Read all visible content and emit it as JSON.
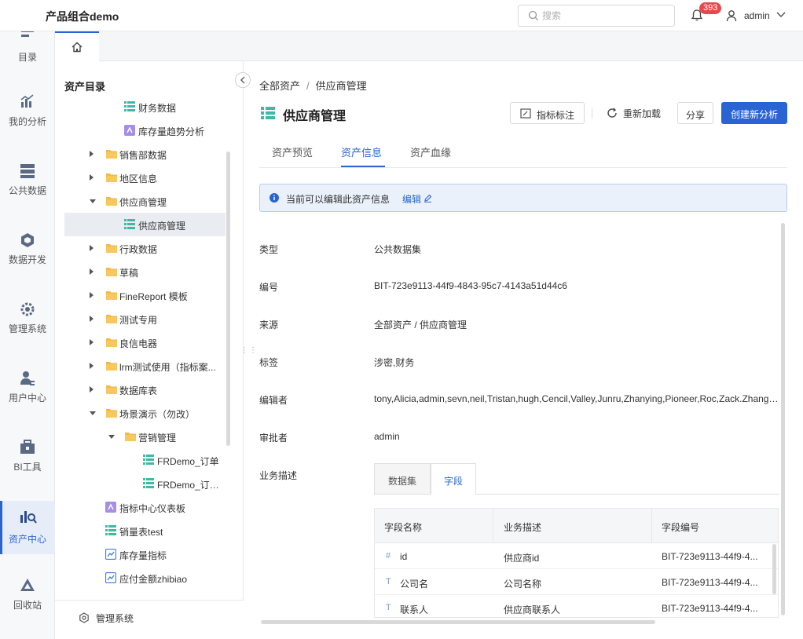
{
  "app": {
    "title": "产品组合demo"
  },
  "header": {
    "search_placeholder": "搜索",
    "notification_count": "393",
    "user": "admin"
  },
  "leftnav": [
    {
      "label": "目录",
      "icon": "catalog-icon"
    },
    {
      "label": "我的分析",
      "icon": "chart-icon"
    },
    {
      "label": "公共数据",
      "icon": "database-icon"
    },
    {
      "label": "数据开发",
      "icon": "cube-icon"
    },
    {
      "label": "管理系统",
      "icon": "gear-icon"
    },
    {
      "label": "用户中心",
      "icon": "user-icon"
    },
    {
      "label": "BI工具",
      "icon": "toolbox-icon"
    },
    {
      "label": "资产中心",
      "icon": "asset-search-icon",
      "active": true
    },
    {
      "label": "回收站",
      "icon": "recycle-icon"
    }
  ],
  "tree": {
    "title": "资产目录",
    "items": [
      {
        "label": "财务数据",
        "type": "dataset"
      },
      {
        "label": "库存量趋势分析",
        "type": "analysis"
      },
      {
        "label": "销售部数据",
        "type": "folder"
      },
      {
        "label": "地区信息",
        "type": "folder"
      },
      {
        "label": "供应商管理",
        "type": "folder"
      },
      {
        "label": "供应商管理",
        "type": "dataset"
      },
      {
        "label": "行政数据",
        "type": "folder"
      },
      {
        "label": "草稿",
        "type": "folder"
      },
      {
        "label": "FineReport 模板",
        "type": "folder"
      },
      {
        "label": "测试专用",
        "type": "folder"
      },
      {
        "label": "良信电器",
        "type": "folder"
      },
      {
        "label": "lrm测试使用（指标案...",
        "type": "folder"
      },
      {
        "label": "数据库表",
        "type": "folder"
      },
      {
        "label": "场景演示（勿改）",
        "type": "folder"
      },
      {
        "label": "营销管理",
        "type": "folder"
      },
      {
        "label": "FRDemo_订单",
        "type": "dataset"
      },
      {
        "label": "FRDemo_订单...",
        "type": "dataset"
      },
      {
        "label": "指标中心仪表板",
        "type": "analysis"
      },
      {
        "label": "销量表test",
        "type": "dataset"
      },
      {
        "label": "库存量指标",
        "type": "metric"
      },
      {
        "label": "应付金额zhibiao",
        "type": "metric"
      }
    ],
    "footer": "管理系统"
  },
  "breadcrumb": {
    "root": "全部资产",
    "sep": "/",
    "current": "供应商管理"
  },
  "page": {
    "title": "供应商管理",
    "btn_metric": "指标标注",
    "btn_reload": "重新加载",
    "btn_share": "分享",
    "btn_create": "创建新分析"
  },
  "tabs": [
    "资产预览",
    "资产信息",
    "资产血缘"
  ],
  "notice": {
    "text": "当前可以编辑此资产信息",
    "edit": "编辑"
  },
  "fields": [
    {
      "label": "类型",
      "value": "公共数据集"
    },
    {
      "label": "编号",
      "value": "BIT-723e9113-44f9-4843-95c7-4143a51d44c6"
    },
    {
      "label": "来源",
      "value": "全部资产 / 供应商管理"
    },
    {
      "label": "标签",
      "value": "涉密,财务"
    },
    {
      "label": "编辑者",
      "value": "tony,Alicia,admin,sevn,neil,Tristan,hugh,Cencil,Valley,Junru,Zhanying,Pioneer,Roc,Zack.Zhang,Leon..."
    },
    {
      "label": "审批者",
      "value": "admin"
    },
    {
      "label": "业务描述",
      "value": ""
    }
  ],
  "subtabs": [
    "数据集",
    "字段"
  ],
  "table": {
    "headers": [
      "字段名称",
      "业务描述",
      "字段编号"
    ],
    "rows": [
      {
        "type": "#",
        "name": "id",
        "desc": "供应商id",
        "code": "BIT-723e9113-44f9-4..."
      },
      {
        "type": "T",
        "name": "公司名",
        "desc": "公司名称",
        "code": "BIT-723e9113-44f9-4..."
      },
      {
        "type": "T",
        "name": "联系人",
        "desc": "供应商联系人",
        "code": "BIT-723e9113-44f9-4..."
      }
    ]
  },
  "colors": {
    "accent": "#2a64d3",
    "folder": "#f5b94a",
    "dataset": "#3fb8a6",
    "analysis": "#8a6bd8",
    "badge": "#e5484d"
  }
}
